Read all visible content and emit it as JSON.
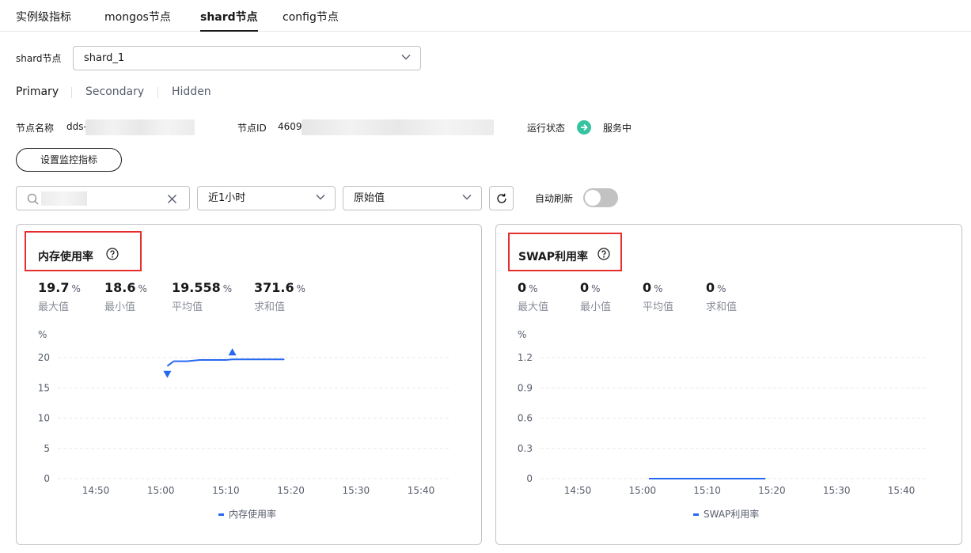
{
  "tabs": [
    {
      "label": "实例级指标"
    },
    {
      "label": "mongos节点"
    },
    {
      "label": "shard节点"
    },
    {
      "label": "config节点"
    }
  ],
  "shard_select": {
    "label": "shard节点",
    "value": "shard_1"
  },
  "roles": [
    {
      "label": "Primary"
    },
    {
      "label": "Secondary"
    },
    {
      "label": "Hidden"
    }
  ],
  "info": {
    "name_label": "节点名称",
    "name_value": "dds-",
    "id_label": "节点ID",
    "id_value": "4609",
    "status_label": "运行状态",
    "status_value": "服务中"
  },
  "buttons": {
    "set_metrics": "设置监控指标"
  },
  "filters": {
    "search_placeholder": "",
    "time_range": "近1小时",
    "value_type": "原始值",
    "auto_refresh_label": "自动刷新",
    "auto_refresh_on": false
  },
  "cards": [
    {
      "title": "内存使用率",
      "stats": [
        {
          "value": "19.7",
          "unit": "%",
          "label": "最大值"
        },
        {
          "value": "18.6",
          "unit": "%",
          "label": "最小值"
        },
        {
          "value": "19.558",
          "unit": "%",
          "label": "平均值"
        },
        {
          "value": "371.6",
          "unit": "%",
          "label": "求和值"
        }
      ],
      "unit_label": "%",
      "legend": "内存使用率"
    },
    {
      "title": "SWAP利用率",
      "stats": [
        {
          "value": "0",
          "unit": "%",
          "label": "最大值"
        },
        {
          "value": "0",
          "unit": "%",
          "label": "最小值"
        },
        {
          "value": "0",
          "unit": "%",
          "label": "平均值"
        },
        {
          "value": "0",
          "unit": "%",
          "label": "求和值"
        }
      ],
      "unit_label": "%",
      "legend": "SWAP利用率"
    }
  ],
  "colors": {
    "series": "#2468f2",
    "status_ok": "#36c4a0",
    "highlight": "#e62e2e"
  },
  "chart_data": [
    {
      "type": "line",
      "ylabel": "%",
      "ylim": [
        0,
        20
      ],
      "yticks": [
        "0",
        "5",
        "10",
        "15",
        "20"
      ],
      "xticks": [
        "14:50",
        "15:00",
        "15:10",
        "15:20",
        "15:30",
        "15:40"
      ],
      "x_range_min": [
        45,
        69
      ],
      "series": [
        {
          "name": "内存使用率",
          "points": [
            [
              61,
              18.6
            ],
            [
              62,
              19.4
            ],
            [
              64,
              19.4
            ],
            [
              66,
              19.6
            ],
            [
              70,
              19.6
            ],
            [
              71,
              19.7
            ],
            [
              79,
              19.7
            ]
          ],
          "max_marker": [
            71,
            19.7
          ],
          "min_marker": [
            61,
            18.6
          ]
        }
      ],
      "legend_position": "bottom",
      "grid": true
    },
    {
      "type": "line",
      "ylabel": "%",
      "ylim": [
        0,
        1.2
      ],
      "yticks": [
        "0",
        "0.3",
        "0.6",
        "0.9",
        "1.2"
      ],
      "xticks": [
        "14:50",
        "15:00",
        "15:10",
        "15:20",
        "15:30",
        "15:40"
      ],
      "series": [
        {
          "name": "SWAP利用率",
          "points": [
            [
              61,
              0
            ],
            [
              79,
              0
            ]
          ]
        }
      ],
      "legend_position": "bottom",
      "grid": true
    }
  ]
}
